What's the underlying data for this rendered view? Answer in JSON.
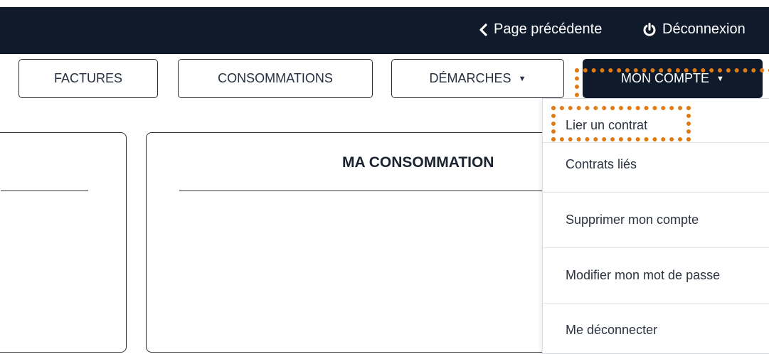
{
  "topbar": {
    "prev_label": "Page précédente",
    "prev_icon": "chevron-left-icon",
    "logout_label": "Déconnexion",
    "logout_icon": "power-icon",
    "background": "#0f1a2a"
  },
  "nav": {
    "factures": "FACTURES",
    "consommations": "CONSOMMATIONS",
    "demarches": "DÉMARCHES",
    "mon_compte": "MON COMPTE"
  },
  "main": {
    "consumption_title": "MA CONSOMMATION"
  },
  "account_menu": {
    "items": [
      "Lier un contrat",
      "Contrats liés",
      "Supprimer mon compte",
      "Modifier mon mot de passe",
      "Me déconnecter"
    ]
  },
  "colors": {
    "accent_highlight": "#e07a12",
    "dark": "#0f1a2a"
  }
}
